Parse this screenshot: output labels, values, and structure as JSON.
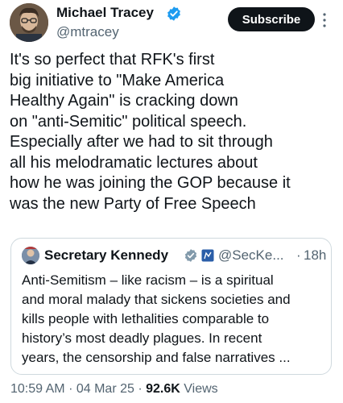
{
  "author": {
    "name": "Michael Tracey",
    "handle": "@mtracey",
    "verified_color": "#1d9bf0"
  },
  "subscribe_label": "Subscribe",
  "tweet": {
    "lines": [
      "It's so perfect that RFK's first",
      "big initiative to \"Make America",
      "Healthy Again\" is cracking down",
      "on \"anti-Semitic\" political speech.",
      "Especially after we had to sit through",
      "all his melodramatic lectures about",
      "how he was joining the GOP because it",
      "was the new Party of Free Speech"
    ]
  },
  "quote": {
    "name": "Secretary Kennedy",
    "handle": "@SecKe...",
    "separator": "·",
    "time": "18h",
    "verified_color": "#829aab",
    "lines": [
      "Anti-Semitism – like racism – is a spiritual",
      "and moral malady that sickens societies and",
      "kills people with lethalities comparable to",
      "history’s most deadly plagues. In recent",
      "years, the censorship and false narratives ..."
    ]
  },
  "meta": {
    "time": "10:59 AM",
    "sep1": "·",
    "date": "04 Mar 25",
    "sep2": "·",
    "views_count": "92.6K",
    "views_label": "Views"
  }
}
